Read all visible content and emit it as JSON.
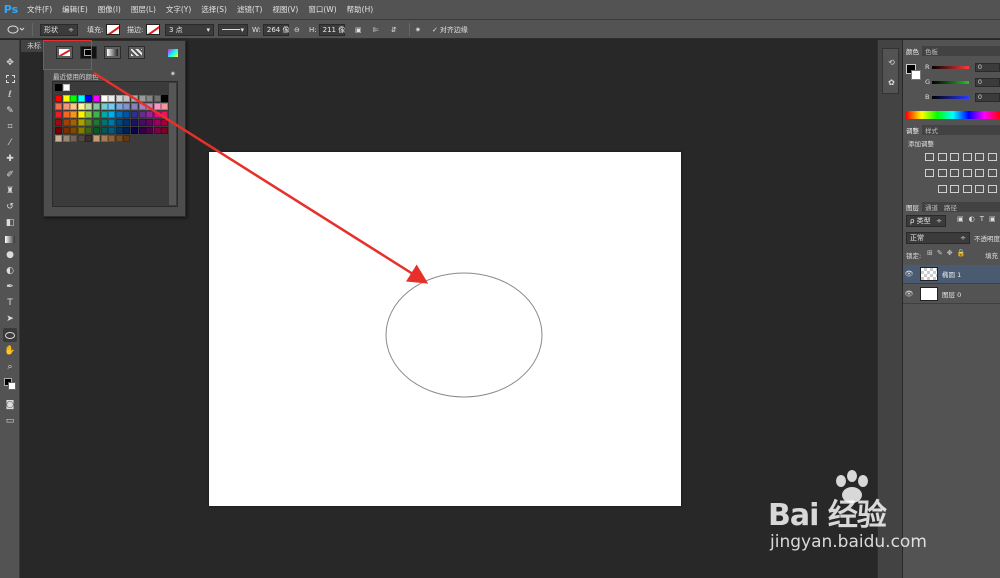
{
  "app": {
    "logo": "Ps"
  },
  "menu": {
    "items": [
      "文件(F)",
      "编辑(E)",
      "图像(I)",
      "图层(L)",
      "文字(Y)",
      "选择(S)",
      "滤镜(T)",
      "视图(V)",
      "窗口(W)",
      "帮助(H)"
    ]
  },
  "options": {
    "mode": "形状",
    "fill_label": "填充:",
    "stroke_label": "描边:",
    "stroke_size": "3 点",
    "w_label": "W:",
    "w_value": "264 像",
    "h_label": "H:",
    "h_value": "211 像",
    "align_edges": "对齐边缘"
  },
  "document": {
    "tab": "未标"
  },
  "swatch_popup": {
    "label": "最近使用的颜色",
    "recent": [
      "#000000",
      "#ffffff"
    ],
    "rows": [
      [
        "#ff0000",
        "#ffff00",
        "#00ff00",
        "#00ffff",
        "#0000ff",
        "#ff00ff",
        "#ffffff",
        "#ebebeb",
        "#d6d6d6",
        "#c2c2c2",
        "#adadad",
        "#999999",
        "#858585",
        "#707070",
        "#000000"
      ],
      [
        "#f26c4f",
        "#f69679",
        "#fdc689",
        "#fff799",
        "#c4df9b",
        "#82ca9c",
        "#7accc8",
        "#6dcff6",
        "#7da7d9",
        "#8393ca",
        "#8781bd",
        "#a186be",
        "#bd8cbf",
        "#f49ac1",
        "#f5989d"
      ],
      [
        "#ed1c24",
        "#f26522",
        "#f7941d",
        "#fff200",
        "#8dc63f",
        "#39b54a",
        "#00a99d",
        "#00aeef",
        "#0072bc",
        "#0054a6",
        "#2e3192",
        "#662d91",
        "#92278f",
        "#ec008c",
        "#ed145b"
      ],
      [
        "#9e0b0f",
        "#a0410d",
        "#a36209",
        "#aba000",
        "#598527",
        "#197b30",
        "#00746b",
        "#0076a3",
        "#004a80",
        "#003471",
        "#1b1464",
        "#440e62",
        "#630460",
        "#9e005d",
        "#9e0039"
      ],
      [
        "#790000",
        "#7b2e00",
        "#7d4900",
        "#827b00",
        "#406618",
        "#005e20",
        "#005952",
        "#005b7f",
        "#003663",
        "#002157",
        "#0d004c",
        "#32004b",
        "#4b0049",
        "#7b0046",
        "#7a0026"
      ],
      [
        "#c7b299",
        "#998675",
        "#736357",
        "#534741",
        "#37302d",
        "#c69c6d",
        "#a67c52",
        "#8c6239",
        "#754c24",
        "#603913"
      ]
    ]
  },
  "dock": {
    "icons": [
      "history-icon",
      "brush-preset-icon"
    ]
  },
  "panels": {
    "color": {
      "tabs": [
        "颜色",
        "色板"
      ],
      "channels": [
        {
          "name": "R",
          "value": "0",
          "gradient": "#ff3b3b"
        },
        {
          "name": "G",
          "value": "0",
          "gradient": "#22c22a"
        },
        {
          "name": "B",
          "value": "0",
          "gradient": "#2a3cff"
        }
      ]
    },
    "adjustments": {
      "tabs": [
        "调整",
        "样式"
      ],
      "title": "添加调整"
    },
    "layers": {
      "tabs": [
        "图层",
        "通道",
        "路径"
      ],
      "filter_label": "ρ 类型",
      "blend_mode": "正常",
      "opacity_label": "不透明度",
      "lock_label": "锁定:",
      "fill_label": "填充",
      "items": [
        {
          "name": "椭圆 1",
          "selected": true
        },
        {
          "name": "图层 0",
          "selected": false
        }
      ]
    }
  },
  "watermark": {
    "logo": "Bai  经验",
    "url": "jingyan.baidu.com"
  }
}
